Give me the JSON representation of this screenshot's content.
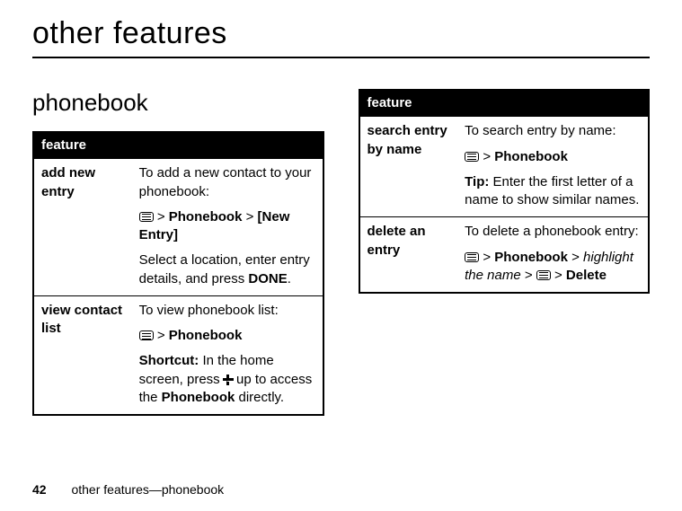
{
  "page_title": "other features",
  "section_title": "phonebook",
  "left_table": {
    "header": "feature",
    "rows": [
      {
        "label": "add new entry",
        "p1_text": "To add a new contact to your phonebook:",
        "p2_nav1": "Phonebook",
        "p2_nav2": "[New Entry]",
        "p3_a": "Select a location, enter entry details, and press ",
        "p3_done": "DONE",
        "p3_b": "."
      },
      {
        "label": "view contact list",
        "p1_text": "To view phonebook list:",
        "p2_nav1": "Phonebook",
        "p3_bold": "Shortcut:",
        "p3_a": " In the home screen, press ",
        "p3_b": " up to access the ",
        "p3_pb": "Phonebook",
        "p3_c": " directly."
      }
    ]
  },
  "right_table": {
    "header": "feature",
    "rows": [
      {
        "label": "search entry by name",
        "p1_text": "To search entry by name:",
        "p2_nav1": "Phonebook",
        "p3_bold": "Tip:",
        "p3_a": " Enter the first letter of a name to show similar names."
      },
      {
        "label": "delete an entry",
        "p1_text": "To delete a phonebook entry:",
        "p2_nav1": "Phonebook",
        "p2_hl": "highlight the name",
        "p2_del": "Delete"
      }
    ]
  },
  "footer": {
    "page_number": "42",
    "breadcrumb": "other features—phonebook"
  },
  "gt": ">"
}
